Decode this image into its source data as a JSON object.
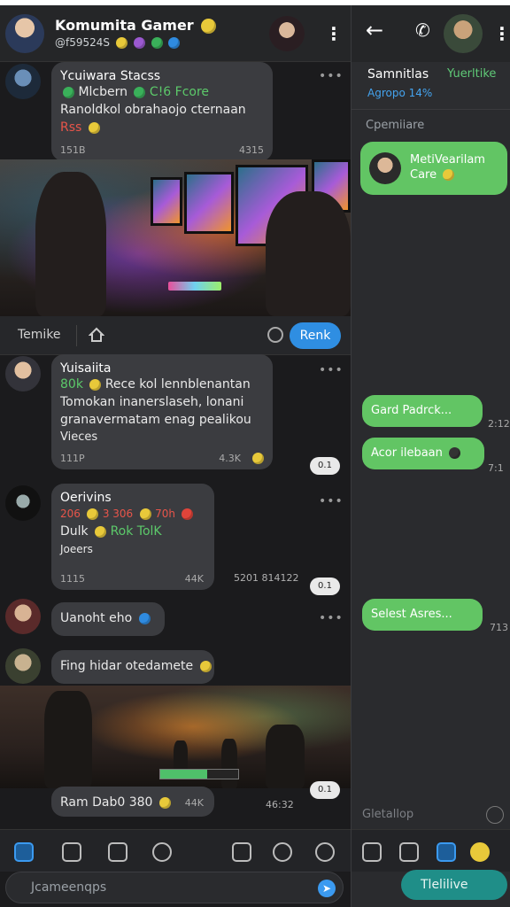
{
  "left": {
    "header": {
      "title": "Komumita Gamer",
      "subtitle": "@f59524S"
    },
    "messages": [
      {
        "name": "Ycuiwara Stacss",
        "line1": "Mlcbern",
        "line1b": "C!6 Fcore",
        "line2": "Ranoldkol obrahaojo cternaan",
        "line3": "Rss",
        "meta_left": "151B",
        "meta_right": "4315"
      },
      {
        "name": "Yuisaiita",
        "line1a": "80k",
        "line1b": "Rece kol lennblenantan",
        "line2": "Tomokan inanerslaseh, lonani",
        "line3": "granavermatam enag pealikou",
        "line4": "Vieces",
        "meta_left": "111P",
        "meta_right": "4.3K",
        "read": "0.1"
      },
      {
        "name": "Oerivins",
        "line1": "206",
        "line1b": "3 306",
        "line1c": "70h",
        "line2a": "Dulk",
        "line2b": "Rok",
        "line2c": "TolK",
        "line3": "Joeers",
        "meta_left": "1115",
        "meta_right": "44K",
        "outside_ts": "5201 814122",
        "read": "0.1"
      },
      {
        "text": "Uanoht eho"
      },
      {
        "text": "Fing hidar otedamete"
      },
      {
        "text": "Ram Dab0 380",
        "meta_right": "44K",
        "outside_ts": "46:32",
        "read": "0.1"
      }
    ],
    "actionbar": {
      "label": "Temike",
      "reply": "Renk"
    },
    "input_placeholder": "Jcameenqps"
  },
  "right": {
    "contact_name": "Samnitlas",
    "contact_tag": "Yuerltike",
    "contact_sub": "Agropo 14%",
    "section": "Cpemiiare",
    "bubbles": [
      {
        "text": "MetiVearilam Care",
        "time": ""
      },
      {
        "text": "Gard Padrck...",
        "time": "2:12"
      },
      {
        "text": "Acor ilebaan",
        "time": "7:1"
      },
      {
        "text": "Selest Asres...",
        "time": "713"
      }
    ],
    "input_placeholder": "Gletallop",
    "new_chat": "Tlelilive"
  },
  "colors": {
    "accent_blue": "#2f8ee2",
    "bubble_green": "#62c564",
    "teal_button": "#1f8e88"
  }
}
